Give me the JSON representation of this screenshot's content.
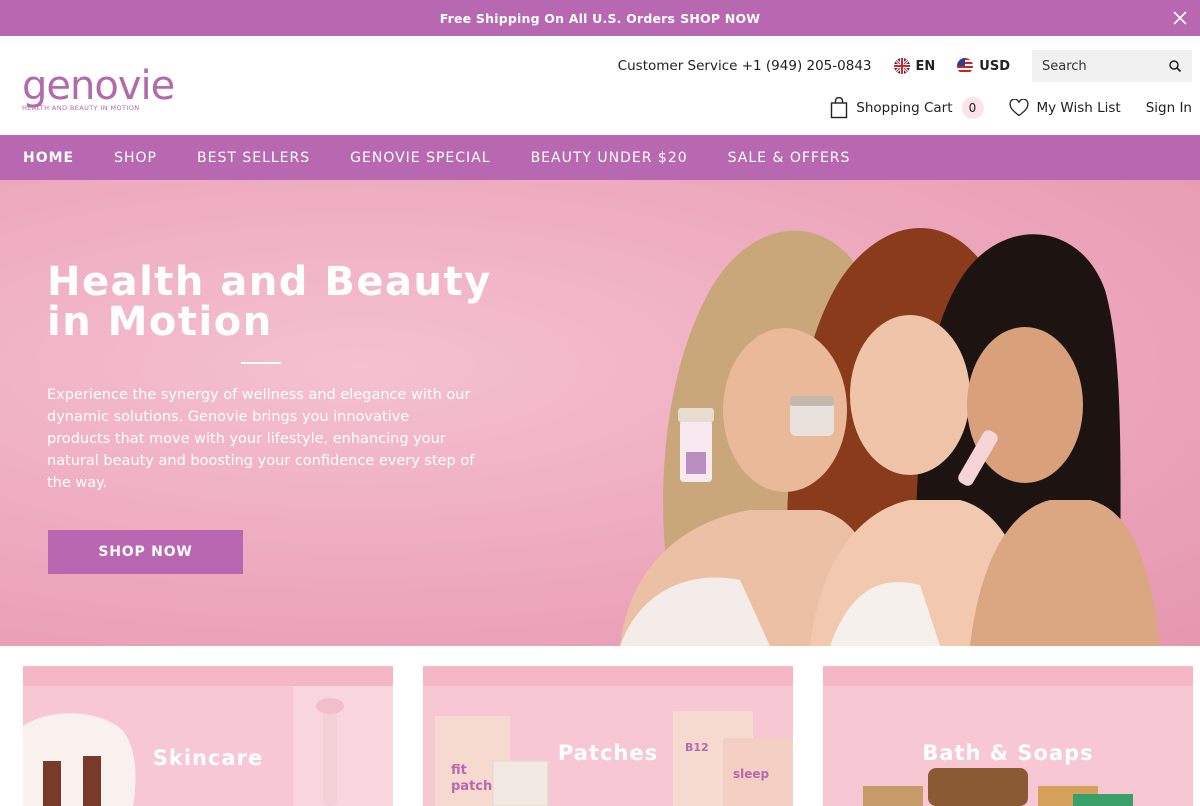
{
  "announcement": {
    "text": "Free Shipping On All U.S. Orders",
    "link": "SHOP NOW"
  },
  "header": {
    "logo_word": "genovie",
    "logo_tagline": "HEALTH AND BEAUTY IN MOTION",
    "customer_service": "Customer Service +1 (949) 205-0843",
    "language": "EN",
    "currency": "USD",
    "search_placeholder": "Search",
    "cart_label": "Shopping Cart",
    "cart_count": "0",
    "wishlist_label": "My Wish List",
    "signin_label": "Sign In"
  },
  "nav": {
    "items": [
      {
        "label": "HOME"
      },
      {
        "label": "SHOP"
      },
      {
        "label": "BEST SELLERS"
      },
      {
        "label": "GENOVIE SPECIAL"
      },
      {
        "label": "BEAUTY UNDER $20"
      },
      {
        "label": "SALE & OFFERS"
      }
    ]
  },
  "hero": {
    "title": "Health and Beauty in Motion",
    "text": "Experience the synergy of wellness and elegance with our dynamic solutions. Genovie brings you innovative products that move with your lifestyle, enhancing your natural beauty and boosting your confidence every step of the way.",
    "button": "SHOP NOW"
  },
  "categories": [
    {
      "label": "Skincare"
    },
    {
      "label": "Patches"
    },
    {
      "label": "Bath & Soaps"
    }
  ],
  "colors": {
    "brand_purple": "#b768b0",
    "hero_pink": "#eda8bd",
    "card_pink": "#f7c8d3"
  }
}
